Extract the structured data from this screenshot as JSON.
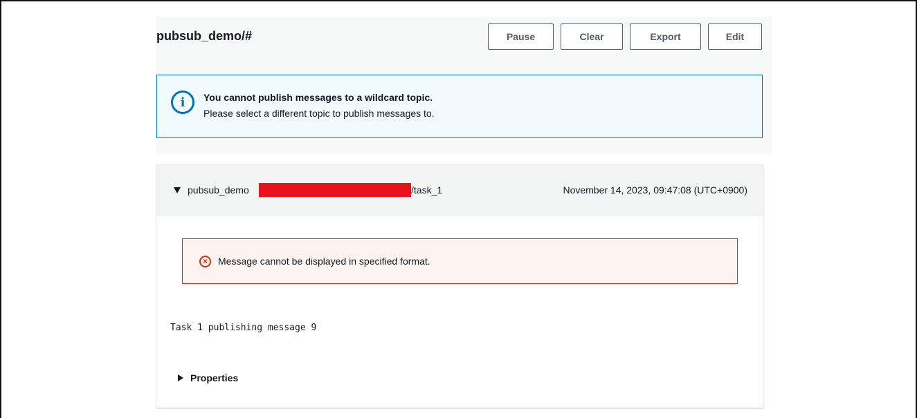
{
  "topic_panel": {
    "title": "pubsub_demo/#",
    "buttons": {
      "pause": "Pause",
      "clear": "Clear",
      "export": "Export",
      "edit": "Edit"
    },
    "info_alert": {
      "icon": "info-icon",
      "icon_glyph": "i",
      "title": "You cannot publish messages to a wildcard topic.",
      "body": "Please select a different topic to publish messages to."
    }
  },
  "message": {
    "topic_prefix": "pubsub_demo",
    "topic_suffix": "/task_1",
    "timestamp": "November 14, 2023, 09:47:08 (UTC+0900)",
    "error_alert": {
      "icon": "error-circle-icon",
      "icon_glyph": "×",
      "text": "Message cannot be displayed in specified format."
    },
    "payload": "Task 1 publishing message 9",
    "properties_label": "Properties"
  },
  "colors": {
    "info_border": "#0073bb",
    "info_background": "#f1faff",
    "error_border": "#d13212",
    "error_background": "#fdf3f1",
    "redaction": "#e8141c",
    "button_border": "#545b64"
  }
}
